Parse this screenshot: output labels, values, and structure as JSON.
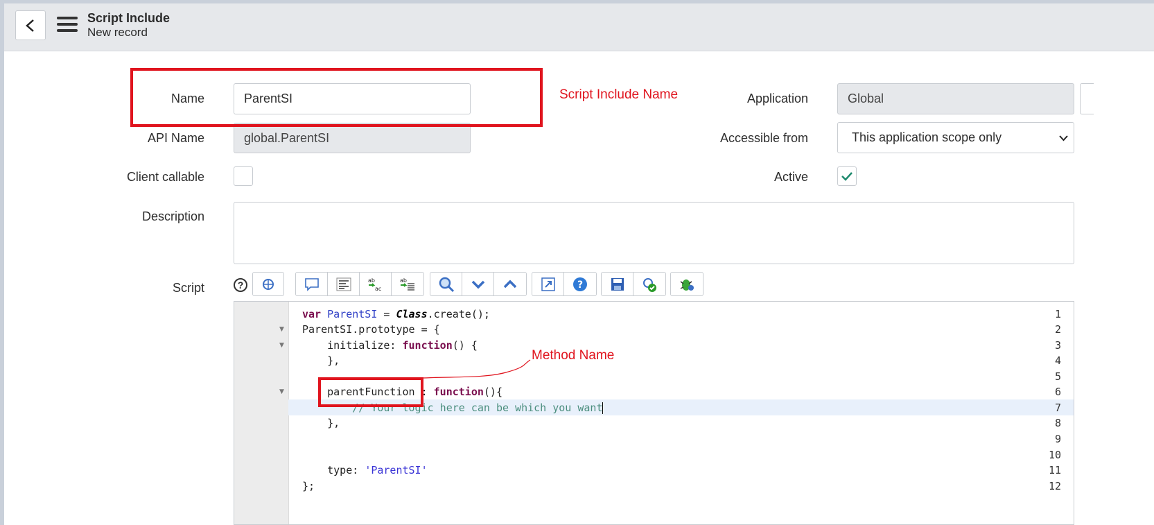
{
  "header": {
    "title": "Script Include",
    "subtitle": "New record"
  },
  "form": {
    "name": {
      "label": "Name",
      "value": "ParentSI"
    },
    "api_name": {
      "label": "API Name",
      "value": "global.ParentSI"
    },
    "client_callable": {
      "label": "Client callable",
      "checked": false
    },
    "description": {
      "label": "Description",
      "value": ""
    },
    "script": {
      "label": "Script",
      "help": "?"
    },
    "application": {
      "label": "Application",
      "value": "Global"
    },
    "accessible_from": {
      "label": "Accessible from",
      "value": "This application scope only"
    },
    "active": {
      "label": "Active",
      "checked": true
    }
  },
  "annotations": {
    "name_note": "Script Include Name",
    "method_note": "Method Name"
  },
  "toolbar": {
    "icons": [
      "format-code-icon",
      "comment-icon",
      "format-icon",
      "replace-icon",
      "replace-all-icon",
      "search-icon",
      "next-icon",
      "previous-icon",
      "fullscreen-icon",
      "help-icon",
      "save-icon",
      "validate-icon",
      "debug-icon"
    ]
  },
  "code": {
    "line_numbers": [
      "1",
      "2",
      "3",
      "4",
      "5",
      "6",
      "7",
      "8",
      "9",
      "10",
      "11",
      "12"
    ],
    "lines": {
      "l1_kw": "var",
      "l1_name": "ParentSI",
      "l1_eq": " = ",
      "l1_cls": "Class",
      "l1_rest": ".create();",
      "l2": "ParentSI.prototype = {",
      "l3_a": "    initialize: ",
      "l3_kw": "function",
      "l3_b": "() {",
      "l4": "    },",
      "l6_a": "    parentFunction : ",
      "l6_kw": "function",
      "l6_b": "(){",
      "l7": "        // Your logic here can be which you want",
      "l8": "    },",
      "l11_a": "    type: ",
      "l11_str": "'ParentSI'",
      "l12": "};"
    }
  }
}
